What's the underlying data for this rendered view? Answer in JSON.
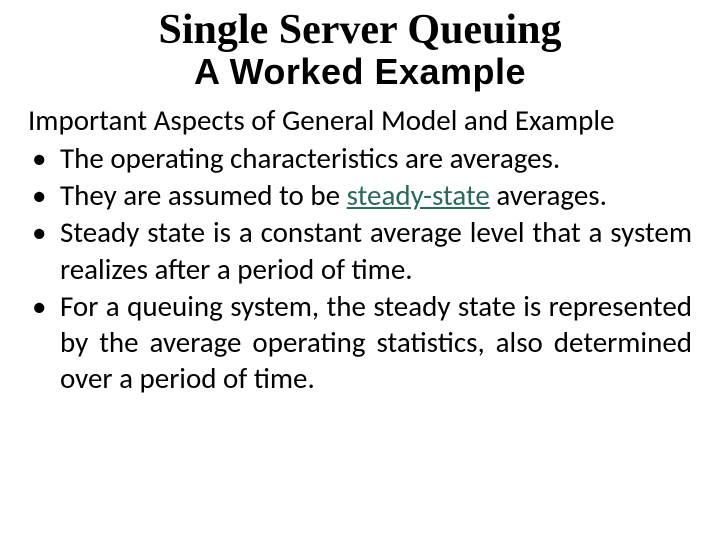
{
  "title": {
    "main": "Single Server Queuing",
    "sub": "A Worked Example"
  },
  "heading": "Important Aspects of General Model and Example",
  "bullets": [
    {
      "text": "The operating characteristics are averages."
    },
    {
      "pre": "They are assumed to be ",
      "emph": "steady-state",
      "post": " averages."
    },
    {
      "text": "Steady state is a constant average level that a system realizes after a period of time."
    },
    {
      "text": "For a queuing system, the steady state is represented by the average operating statistics, also determined over a period of time."
    }
  ]
}
